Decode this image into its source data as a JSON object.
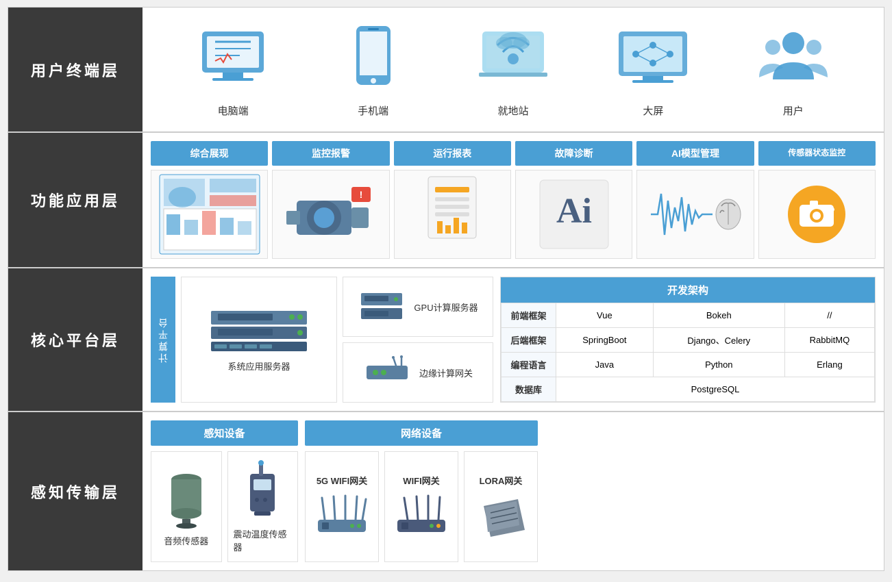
{
  "rows": [
    {
      "id": "terminal",
      "label": "用户终端层",
      "terminals": [
        {
          "id": "pc",
          "label": "电脑端"
        },
        {
          "id": "mobile",
          "label": "手机端"
        },
        {
          "id": "local-station",
          "label": "就地站"
        },
        {
          "id": "big-screen",
          "label": "大屏"
        },
        {
          "id": "user",
          "label": "用户"
        }
      ]
    },
    {
      "id": "functional",
      "label": "功能应用层",
      "modules": [
        {
          "id": "overview",
          "label": "综合展现"
        },
        {
          "id": "monitor",
          "label": "监控报警"
        },
        {
          "id": "report",
          "label": "运行报表"
        },
        {
          "id": "fault",
          "label": "故障诊断"
        },
        {
          "id": "ai-model",
          "label": "AI模型管理"
        },
        {
          "id": "sensor-monitor",
          "label": "传感器状态监控"
        }
      ]
    },
    {
      "id": "core",
      "label": "核心平台层",
      "computePlatformLabel": "计算平台",
      "servers": [
        {
          "id": "system-server",
          "label": "系统应用服务器"
        },
        {
          "id": "gpu-server",
          "label": "GPU计算服务器"
        },
        {
          "id": "edge-gateway",
          "label": "边缘计算网关"
        }
      ],
      "devFramework": {
        "title": "开发架构",
        "rows": [
          {
            "category": "前端框架",
            "values": [
              "Vue",
              "Bokeh",
              "//"
            ]
          },
          {
            "category": "后端框架",
            "values": [
              "SpringBoot",
              "Django、Celery",
              "RabbitMQ"
            ]
          },
          {
            "category": "编程语言",
            "values": [
              "Java",
              "Python",
              "Erlang"
            ]
          },
          {
            "category": "数据库",
            "values": [
              "PostgreSQL",
              "",
              ""
            ]
          }
        ]
      }
    },
    {
      "id": "sensor",
      "label": "感知传输层",
      "perception": {
        "title": "感知设备",
        "items": [
          {
            "id": "audio-sensor",
            "label": "音频传感器"
          },
          {
            "id": "vibration-sensor",
            "label": "震动温度传感器"
          }
        ]
      },
      "network": {
        "title": "网络设备",
        "items": [
          {
            "id": "5g-wifi",
            "label": "5G WIFI网关"
          },
          {
            "id": "wifi",
            "label": "WIFI网关"
          },
          {
            "id": "lora",
            "label": "LORA网关"
          }
        ]
      }
    }
  ]
}
